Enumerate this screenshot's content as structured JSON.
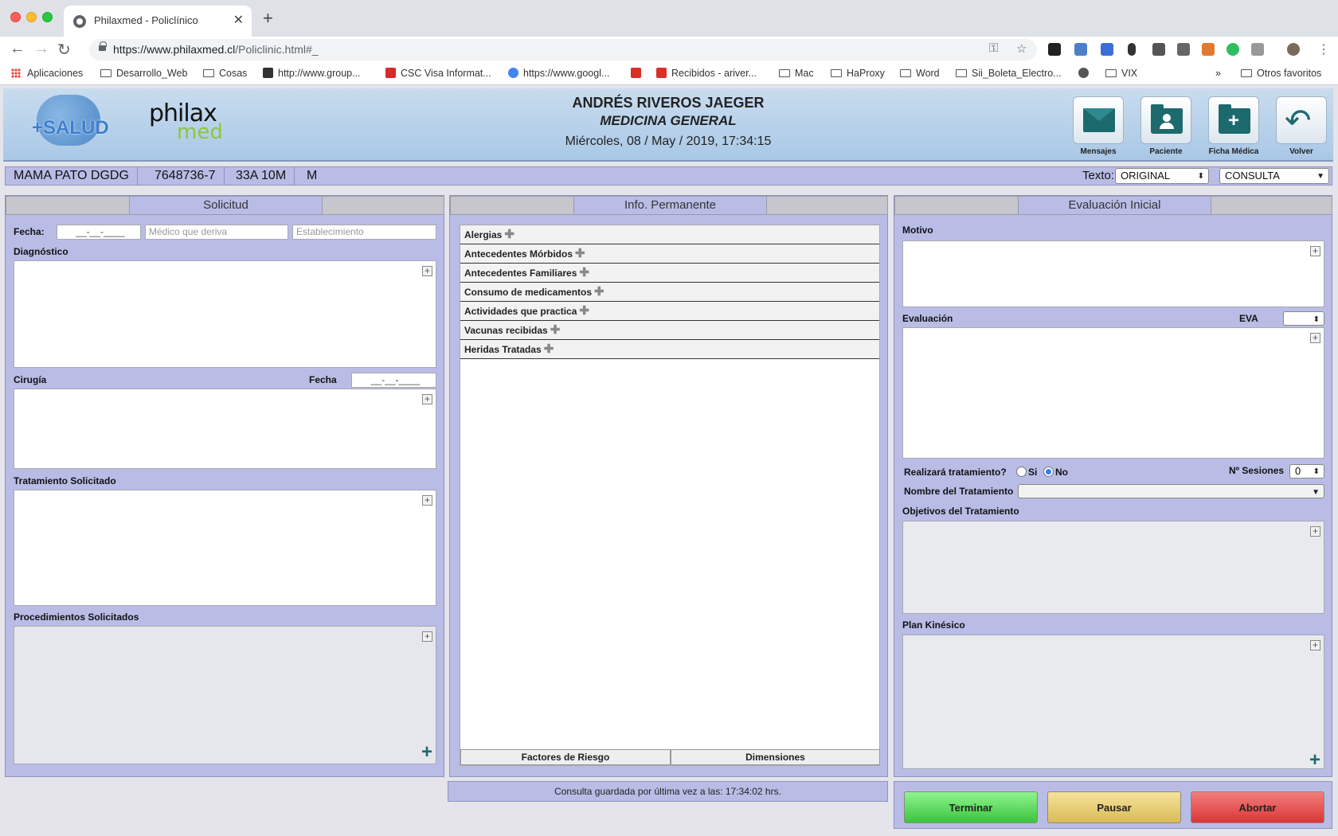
{
  "browser": {
    "tab_title": "Philaxmed - Policlínico",
    "url_host": "https://www.philaxmed.cl",
    "url_path": "/Policlinic.html#_",
    "bookmarks": [
      "Aplicaciones",
      "Desarrollo_Web",
      "Cosas",
      "http://www.group...",
      "CSC Visa Informat...",
      "https://www.googl...",
      "Recibidos - ariver...",
      "Mac",
      "HaProxy",
      "Word",
      "Sii_Boleta_Electro...",
      "VIX",
      "Otros favoritos"
    ]
  },
  "header": {
    "logo_salud": "+SALUD",
    "logo_philax": "philax",
    "logo_med": "med",
    "doctor_name": "ANDRÉS RIVEROS JAEGER",
    "specialty": "MEDICINA GENERAL",
    "datetime": "Miércoles, 08 / May / 2019, 17:34:15",
    "buttons": {
      "mensajes": "Mensajes",
      "paciente": "Paciente",
      "ficha": "Ficha Médica",
      "volver": "Volver"
    }
  },
  "patient": {
    "name": "MAMA PATO DGDG",
    "rut": "7648736-7",
    "age": "33A 10M",
    "sex": "M",
    "texto_label": "Texto:",
    "texto_value": "ORIGINAL",
    "mode_value": "CONSULTA"
  },
  "solicitud": {
    "tab": "Solicitud",
    "fecha_label": "Fecha:",
    "fecha_value": "__-__-____",
    "medico_placeholder": "Médico que deriva",
    "establecimiento_placeholder": "Establecimiento",
    "diagnostico": "Diagnóstico",
    "cirugia": "Cirugía",
    "cirugia_fecha_label": "Fecha",
    "cirugia_fecha_value": "__-__-____",
    "tratamiento": "Tratamiento Solicitado",
    "procedimientos": "Procedimientos Solicitados"
  },
  "info": {
    "tab": "Info. Permanente",
    "items": [
      "Alergias",
      "Antecedentes Mórbidos",
      "Antecedentes Familiares",
      "Consumo de medicamentos",
      "Actividades que practica",
      "Vacunas recibidas",
      "Heridas Tratadas"
    ],
    "bottom_left": "Factores de Riesgo",
    "bottom_right": "Dimensiones"
  },
  "evaluacion": {
    "tab": "Evaluación Inicial",
    "motivo": "Motivo",
    "evaluacion": "Evaluación",
    "eva": "EVA",
    "realizara": "Realizará tratamiento?",
    "si": "Si",
    "no": "No",
    "sesiones_label": "Nº Sesiones",
    "sesiones_value": "0",
    "nombre_tratamiento": "Nombre del Tratamiento",
    "objetivos": "Objetivos del Tratamiento",
    "plan": "Plan Kinésico"
  },
  "status": "Consulta guardada por última vez a las: 17:34:02 hrs.",
  "actions": {
    "terminar": "Terminar",
    "pausar": "Pausar",
    "abortar": "Abortar"
  }
}
